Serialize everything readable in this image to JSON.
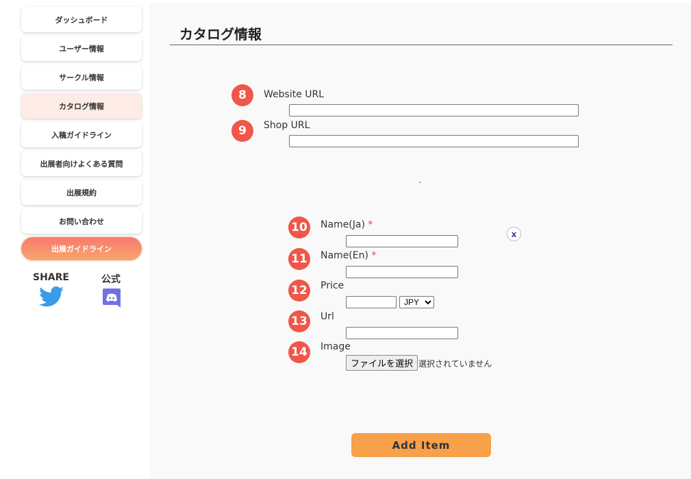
{
  "sidebar": {
    "items": [
      {
        "label": "ダッシュボード"
      },
      {
        "label": "ユーザー情報"
      },
      {
        "label": "サークル情報"
      },
      {
        "label": "カタログ情報",
        "active": true
      },
      {
        "label": "入稿ガイドライン"
      },
      {
        "label": "出展者向けよくある質問"
      },
      {
        "label": "出展規約"
      },
      {
        "label": "お問い合わせ"
      }
    ],
    "guide_button": "出展ガイドライン",
    "share_label": "SHARE",
    "official_label": "公式"
  },
  "main": {
    "title": "カタログ情報",
    "website": {
      "badge": "8",
      "label": "Website URL",
      "value": ""
    },
    "shop": {
      "badge": "9",
      "label": "Shop URL",
      "value": ""
    },
    "item": {
      "name_ja": {
        "badge": "10",
        "label": "Name(Ja)",
        "required": "*"
      },
      "name_en": {
        "badge": "11",
        "label": "Name(En)",
        "required": "*"
      },
      "price": {
        "badge": "12",
        "label": "Price",
        "currency": "JPY"
      },
      "url": {
        "badge": "13",
        "label": "Url"
      },
      "image": {
        "badge": "14",
        "label": "Image",
        "button": "ファイルを選択",
        "status": "選択されていません"
      },
      "remove": "x"
    },
    "add_button": "Add Item"
  },
  "colors": {
    "badge": "#f0564a",
    "add_button": "#f8a04a",
    "active_nav": "#fdebe5"
  }
}
